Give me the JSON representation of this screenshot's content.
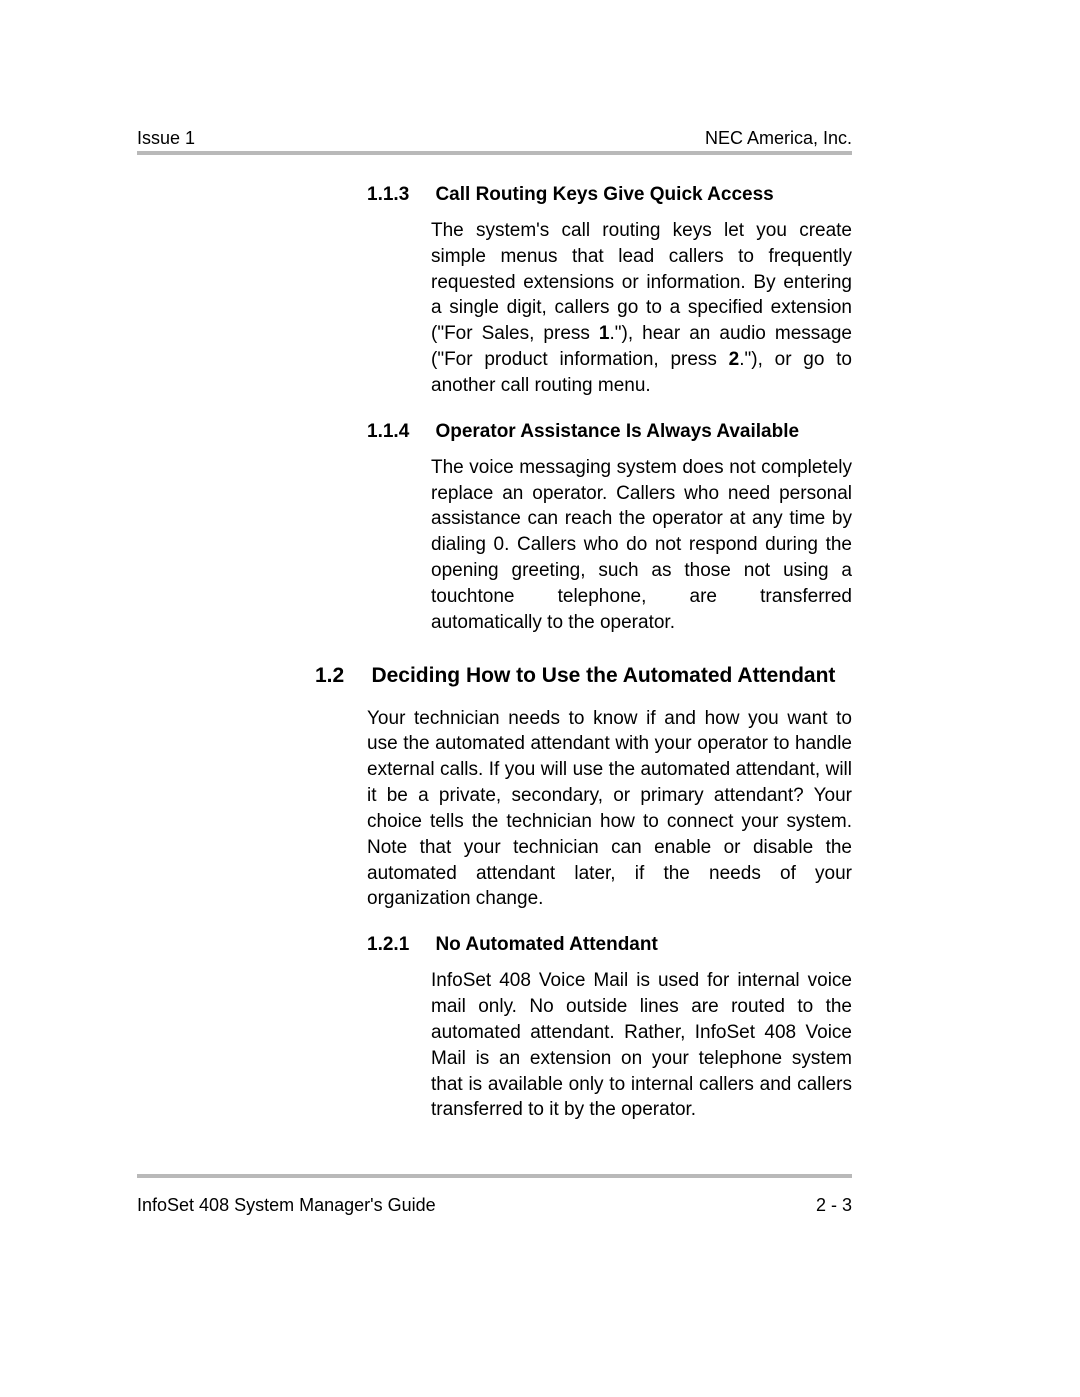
{
  "header": {
    "left": "Issue 1",
    "right": "NEC America, Inc."
  },
  "footer": {
    "left": "InfoSet 408 System Manager's Guide",
    "right": "2 - 3"
  },
  "s113": {
    "num": "1.1.3",
    "title": "Call Routing Keys Give Quick Access",
    "p_a": "The system's call routing keys let you create simple menus that lead callers to frequently requested extensions or information. By entering a single digit, callers go to a specified extension (\"For Sales, press ",
    "key1": "1",
    "p_b": ".\"), hear an audio message (\"For product information, press ",
    "key2": "2",
    "p_c": ".\"), or go to another call routing menu."
  },
  "s114": {
    "num": "1.1.4",
    "title": "Operator Assistance Is Always Available",
    "body": "The voice messaging system does not completely replace an operator. Callers who need personal assistance can reach the operator at any time by dialing 0. Callers who do not respond during the opening greeting, such as those not using a touchtone telephone, are transferred automatically to the operator."
  },
  "s12": {
    "num": "1.2",
    "title": "Deciding How to Use the Automated Attendant",
    "body": "Your technician needs to know if and how you want to use the automated attendant with your operator to handle external calls. If you will use the automated attendant, will it be a private, secondary, or primary attendant? Your choice tells the technician how to connect your system. Note that your technician can enable or disable the automated attendant later, if the needs of your organization change."
  },
  "s121": {
    "num": "1.2.1",
    "title": "No Automated Attendant",
    "body": "InfoSet 408 Voice Mail is used for internal voice mail only. No outside lines are routed to the automated attendant.  Rather, InfoSet 408 Voice Mail is an extension on your telephone system that is available only to internal callers and callers transferred to it by the operator."
  }
}
